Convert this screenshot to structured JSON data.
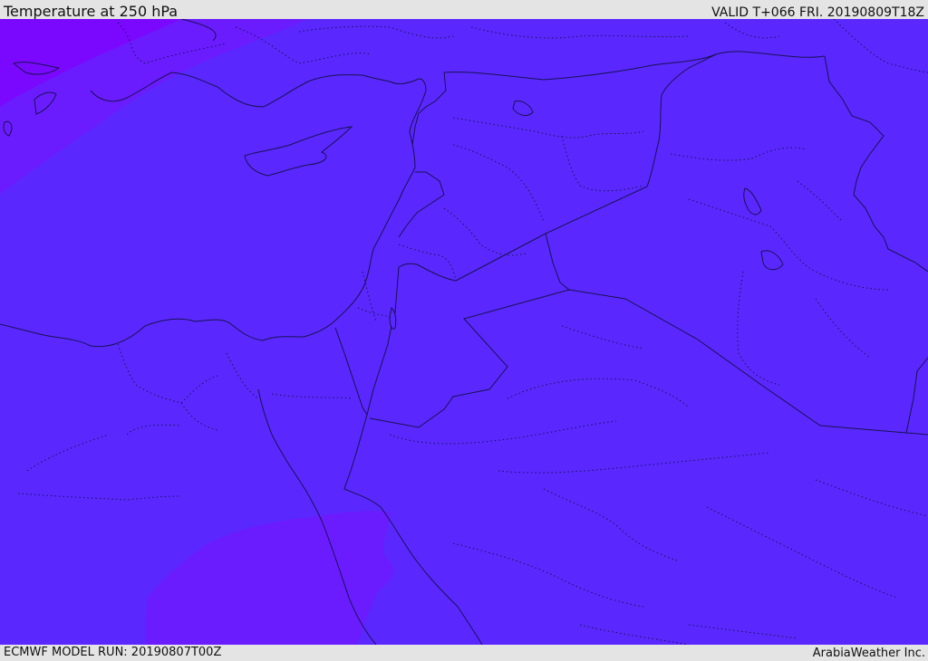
{
  "header": {
    "title": "Temperature at 250 hPa",
    "valid": "VALID T+066 FRI. 20190809T18Z"
  },
  "footer": {
    "model_run": "ECMWF MODEL RUN: 20190807T00Z",
    "credit": "ArabiaWeather Inc."
  },
  "map": {
    "base_color": "#5a28ff",
    "warm_band_color": "#6e1cff",
    "cold_corner_color": "#7a08ff",
    "boundary_color": "#1a1050"
  }
}
